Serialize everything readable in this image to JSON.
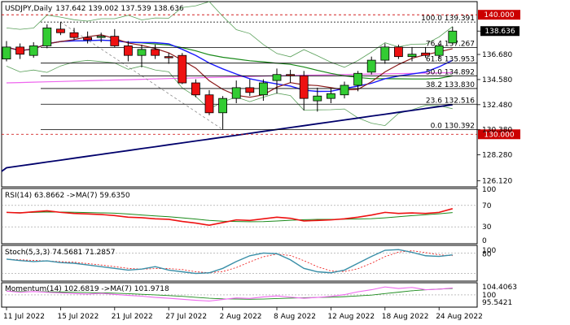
{
  "chart_data": {
    "type": "candlestick",
    "symbol_label": "USDJPY,Daily",
    "ohlc_label": "137.642 139.002 137.539 138.636",
    "y_range": [
      125.6,
      141.1
    ],
    "y_ticks": [
      "138.636",
      "136.680",
      "134.580",
      "132.480",
      "130.380",
      "128.280",
      "126.120"
    ],
    "highlight_levels": [
      {
        "label": "140.000",
        "value": 140.0,
        "color": "#cc0000"
      },
      {
        "label": "130.000",
        "value": 130.0,
        "color": "#cc0000"
      }
    ],
    "current_price": {
      "label": "138.636",
      "value": 138.636
    },
    "fib_levels": [
      {
        "label": "100.0 139.391",
        "value": 139.391
      },
      {
        "label": "76.4 137.267",
        "value": 137.267
      },
      {
        "label": "61.8 135.953",
        "value": 135.953
      },
      {
        "label": "50.0 134.892",
        "value": 134.892
      },
      {
        "label": "38.2 133.830",
        "value": 133.83
      },
      {
        "label": "23.6 132.516",
        "value": 132.516
      },
      {
        "label": "0.0 130.392",
        "value": 130.392
      }
    ],
    "dates": [
      "11 Jul 2022",
      "15 Jul 2022",
      "21 Jul 2022",
      "27 Jul 2022",
      "2 Aug 2022",
      "8 Aug 2022",
      "12 Aug 2022",
      "18 Aug 2022",
      "24 Aug 2022"
    ],
    "date_index": [
      0,
      4,
      8,
      12,
      16,
      20,
      24,
      28,
      32
    ],
    "candles": [
      {
        "o": 136.3,
        "h": 137.8,
        "l": 136.1,
        "c": 137.3
      },
      {
        "o": 137.3,
        "h": 137.6,
        "l": 136.3,
        "c": 136.7
      },
      {
        "o": 136.6,
        "h": 137.7,
        "l": 136.4,
        "c": 137.4
      },
      {
        "o": 137.4,
        "h": 139.2,
        "l": 137.2,
        "c": 138.9
      },
      {
        "o": 138.8,
        "h": 139.4,
        "l": 138.3,
        "c": 138.5
      },
      {
        "o": 138.5,
        "h": 138.9,
        "l": 137.9,
        "c": 138.1
      },
      {
        "o": 138.1,
        "h": 138.6,
        "l": 137.6,
        "c": 137.9
      },
      {
        "o": 138.1,
        "h": 138.5,
        "l": 137.7,
        "c": 138.2
      },
      {
        "o": 138.2,
        "h": 138.8,
        "l": 137.3,
        "c": 137.4
      },
      {
        "o": 137.4,
        "h": 137.8,
        "l": 136.1,
        "c": 136.6
      },
      {
        "o": 136.6,
        "h": 137.5,
        "l": 135.6,
        "c": 137.1
      },
      {
        "o": 137.1,
        "h": 137.5,
        "l": 136.3,
        "c": 136.6
      },
      {
        "o": 136.5,
        "h": 136.8,
        "l": 135.9,
        "c": 136.4
      },
      {
        "o": 136.6,
        "h": 136.8,
        "l": 134.2,
        "c": 134.3
      },
      {
        "o": 134.3,
        "h": 134.6,
        "l": 133.1,
        "c": 133.3
      },
      {
        "o": 133.3,
        "h": 133.7,
        "l": 131.6,
        "c": 131.8
      },
      {
        "o": 131.8,
        "h": 133.2,
        "l": 130.4,
        "c": 133.0
      },
      {
        "o": 133.0,
        "h": 134.5,
        "l": 132.6,
        "c": 133.9
      },
      {
        "o": 133.9,
        "h": 134.6,
        "l": 133.2,
        "c": 133.5
      },
      {
        "o": 133.3,
        "h": 134.6,
        "l": 132.8,
        "c": 134.3
      },
      {
        "o": 134.5,
        "h": 135.5,
        "l": 133.4,
        "c": 135.0
      },
      {
        "o": 135.0,
        "h": 135.4,
        "l": 134.3,
        "c": 134.9
      },
      {
        "o": 134.9,
        "h": 135.3,
        "l": 132.0,
        "c": 133.0
      },
      {
        "o": 132.8,
        "h": 133.9,
        "l": 131.9,
        "c": 133.2
      },
      {
        "o": 133.0,
        "h": 133.8,
        "l": 132.6,
        "c": 133.4
      },
      {
        "o": 133.3,
        "h": 134.4,
        "l": 133.0,
        "c": 134.1
      },
      {
        "o": 134.1,
        "h": 135.3,
        "l": 133.6,
        "c": 135.1
      },
      {
        "o": 135.2,
        "h": 136.5,
        "l": 135.0,
        "c": 136.2
      },
      {
        "o": 136.2,
        "h": 137.6,
        "l": 135.9,
        "c": 137.3
      },
      {
        "o": 137.3,
        "h": 137.5,
        "l": 136.3,
        "c": 136.5
      },
      {
        "o": 136.5,
        "h": 137.3,
        "l": 136.1,
        "c": 136.7
      },
      {
        "o": 136.8,
        "h": 137.3,
        "l": 136.4,
        "c": 136.6
      },
      {
        "o": 136.6,
        "h": 137.5,
        "l": 136.3,
        "c": 137.4
      },
      {
        "o": 137.642,
        "h": 139.002,
        "l": 137.539,
        "c": 138.636
      }
    ],
    "rsi_label": "RSI(14) 63.8662 ->MA(7) 59.6350",
    "rsi_ticks": [
      "100",
      "70",
      "30",
      "0"
    ],
    "stoch_label": "Stoch(5,3,3) 74.5681 71.2857",
    "stoch_ticks": [
      "100",
      "80",
      "20",
      "0"
    ],
    "momentum_label": "Momentum(14) 102.6819 ->MA(7) 101.9718",
    "momentum_ticks": [
      "104.4063",
      "100",
      "95.5421"
    ],
    "colors": {
      "bull": "#33cc33",
      "bear": "#ee1111",
      "ma_fast": "#8b1a1a",
      "ma_mid": "#1a1aff",
      "ma_slow": "#1a8a1a",
      "ma_pink": "#ee66ee",
      "ma_long": "#00006b",
      "bb": "#5aa05a",
      "level": "#000000",
      "red_level": "#cc0000"
    }
  }
}
